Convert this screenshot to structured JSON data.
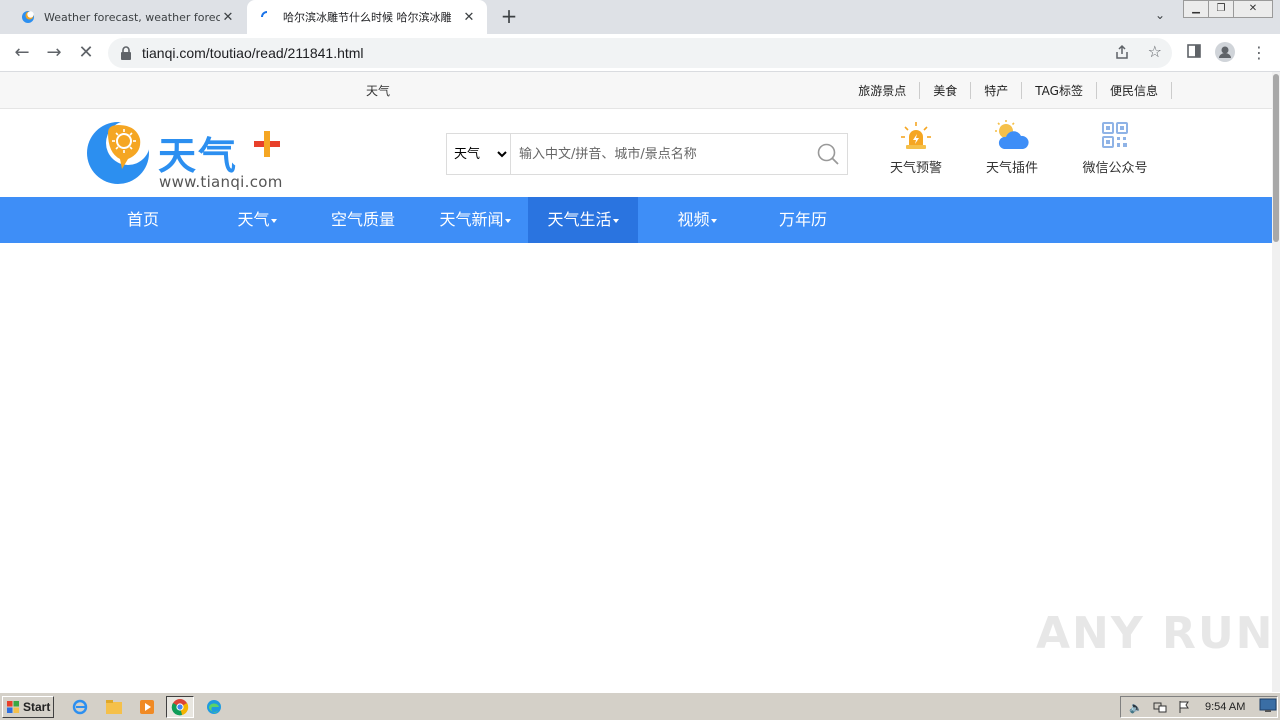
{
  "browser": {
    "tabs": [
      {
        "title": "Weather forecast, weather forecast",
        "active": false
      },
      {
        "title": "哈尔滨冰雕节什么时候 哈尔滨冰雕",
        "active": true
      }
    ],
    "new_tab": "+",
    "url": "tianqi.com/toutiao/read/211841.html"
  },
  "site": {
    "topbar": {
      "brand": "天气",
      "links": [
        "旅游景点",
        "美食",
        "特产",
        "TAG标签",
        "便民信息"
      ]
    },
    "logo": {
      "name": "天气",
      "domain": "www.tianqi.com"
    },
    "search": {
      "select_value": "天气",
      "options": [
        "天气"
      ],
      "placeholder": "输入中文/拼音、城市/景点名称"
    },
    "header_icons": [
      {
        "label": "天气预警",
        "icon": "alert-light-icon"
      },
      {
        "label": "天气插件",
        "icon": "sun-cloud-icon"
      },
      {
        "label": "微信公众号",
        "icon": "qr-code-icon"
      }
    ],
    "nav": [
      {
        "label": "首页",
        "dropdown": false,
        "active": false
      },
      {
        "label": "天气",
        "dropdown": true,
        "active": false
      },
      {
        "label": "空气质量",
        "dropdown": false,
        "active": false
      },
      {
        "label": "天气新闻",
        "dropdown": true,
        "active": false
      },
      {
        "label": "天气生活",
        "dropdown": true,
        "active": true
      },
      {
        "label": "视频",
        "dropdown": true,
        "active": false
      },
      {
        "label": "万年历",
        "dropdown": false,
        "active": false
      }
    ],
    "accent_color": "#3e8ef7"
  },
  "watermark": "ANY RUN",
  "taskbar": {
    "start_label": "Start",
    "clock": "9:54 AM"
  }
}
